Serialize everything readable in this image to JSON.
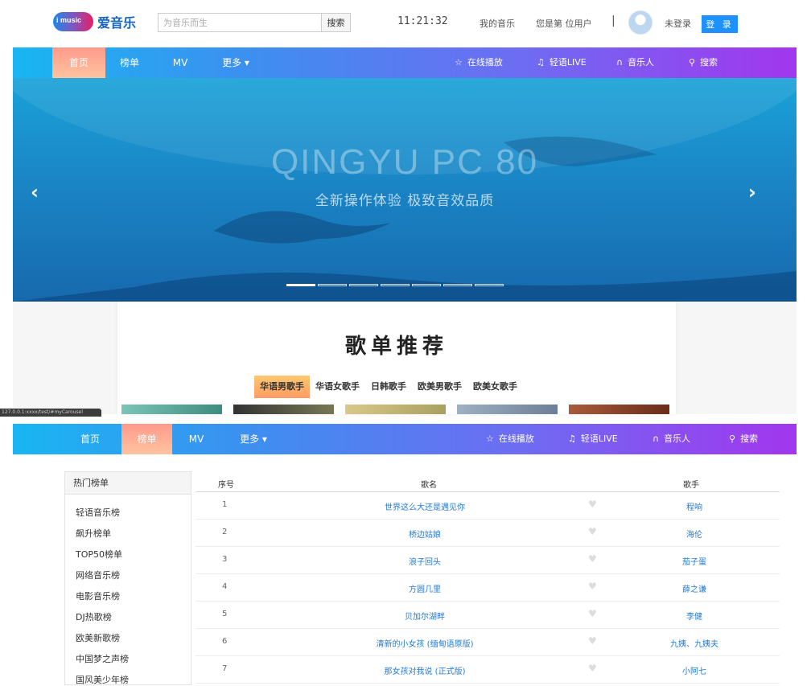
{
  "header": {
    "logo_badge": "i music",
    "logo_text": "爱音乐",
    "search_placeholder": "为音乐而生",
    "search_button": "搜索",
    "clock": "11:21:32",
    "my_music": "我的音乐",
    "visitor_text": "您是第  位用户",
    "separator": "|",
    "not_logged_in": "未登录",
    "login_button": "登 录"
  },
  "nav_top": {
    "items": [
      "首页",
      "榜单",
      "MV",
      "更多 ▾"
    ],
    "right": [
      "在线播放",
      "轻语LIVE",
      "音乐人",
      "搜索"
    ]
  },
  "banner": {
    "title": "QINGYU PC 80",
    "subtitle": "全新操作体验  极致音效品质",
    "prev": "‹",
    "next": "›"
  },
  "playlists": {
    "title": "歌单推荐",
    "categories": [
      "华语男歌手",
      "华语女歌手",
      "日韩歌手",
      "欧美男歌手",
      "欧美女歌手"
    ]
  },
  "status_bar": {
    "url": "127.0.0.1:xxxx/test/#myCarousel"
  },
  "nav_bottom": {
    "items": [
      "首页",
      "榜单",
      "MV",
      "更多 ▾"
    ],
    "right": [
      "在线播放",
      "轻语LIVE",
      "音乐人",
      "搜索"
    ]
  },
  "sidebar": {
    "heading": "热门榜单",
    "items": [
      "轻语音乐榜",
      "飙升榜单",
      "TOP50榜单",
      "网络音乐榜",
      "电影音乐榜",
      "DJ热歌榜",
      "欧美新歌榜",
      "中国梦之声榜",
      "国风美少年榜"
    ]
  },
  "table": {
    "headers": {
      "index": "序号",
      "song": "歌名",
      "singer": "歌手"
    },
    "rows": [
      {
        "index": "1",
        "song": "世界这么大还是遇见你",
        "singer": "程响"
      },
      {
        "index": "2",
        "song": "桥边姑娘",
        "singer": "海伦"
      },
      {
        "index": "3",
        "song": "浪子回头",
        "singer": "茄子蛋"
      },
      {
        "index": "4",
        "song": "方圆几里",
        "singer": "薛之谦"
      },
      {
        "index": "5",
        "song": "贝加尔湖畔",
        "singer": "李健"
      },
      {
        "index": "6",
        "song": "清新的小女孩 (缅甸语原版)",
        "singer": "九姨、九姨夫"
      },
      {
        "index": "7",
        "song": "那女孩对我说 (正式版)",
        "singer": "小阿七"
      }
    ]
  },
  "colors": {
    "accent_blue": "#1f7ad8",
    "login_button": "#1e90ff",
    "active_tab": "#ffb39a"
  }
}
